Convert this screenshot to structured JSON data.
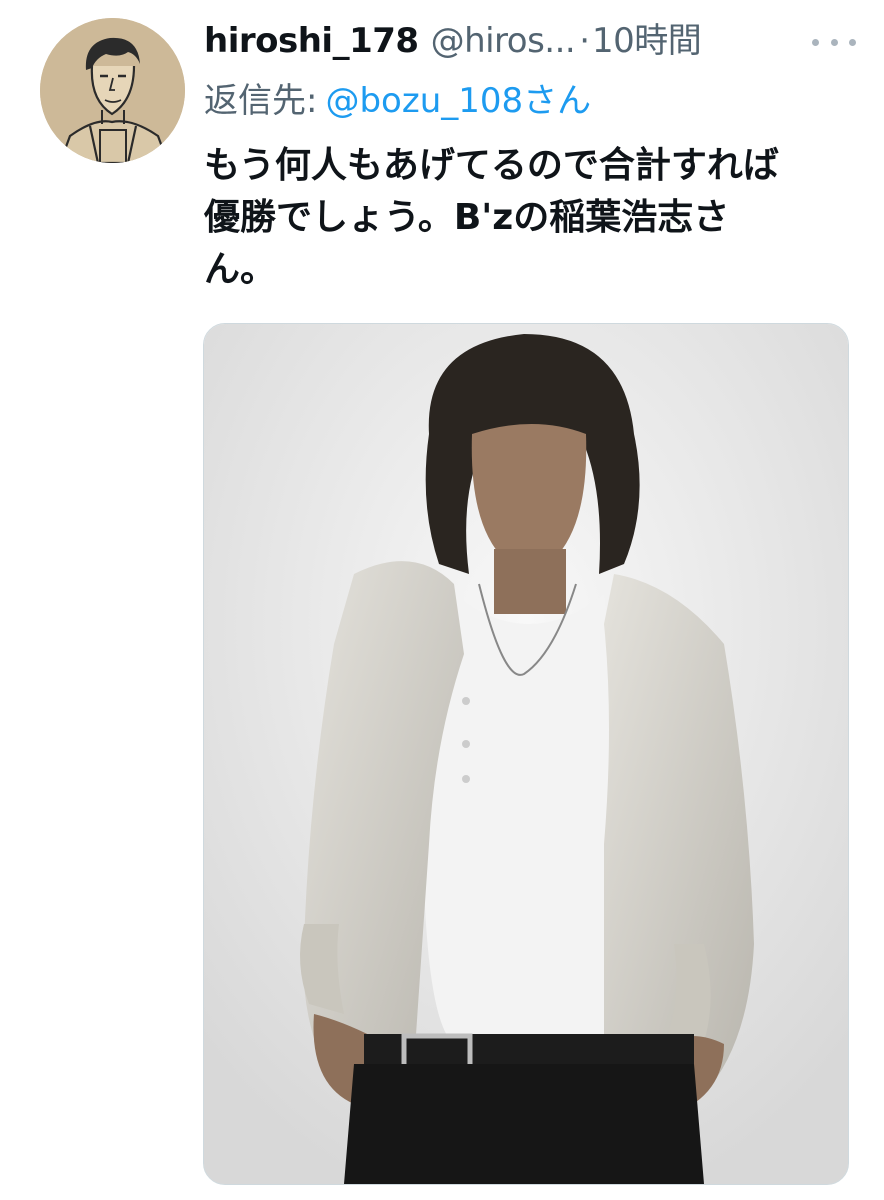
{
  "tweet": {
    "author": {
      "display_name": "hiroshi_178",
      "handle": "@hiros...",
      "avatar_icon": "avatar-illustration-icon"
    },
    "separator": "·",
    "time": "10時間",
    "more_icon": "more-options-icon",
    "reply": {
      "prefix": "返信先:",
      "user": "@bozu_108さん"
    },
    "text_lines": [
      "もう何人もあげてるので合計すれば",
      "優勝でしょう。B'zの稲葉浩志さ",
      "ん。"
    ],
    "media": {
      "type": "photo",
      "icon": "photo-portrait-icon"
    }
  },
  "colors": {
    "text_primary": "#0f1419",
    "text_secondary": "#536471",
    "link": "#1d9bf0",
    "border": "#cfd9de"
  }
}
